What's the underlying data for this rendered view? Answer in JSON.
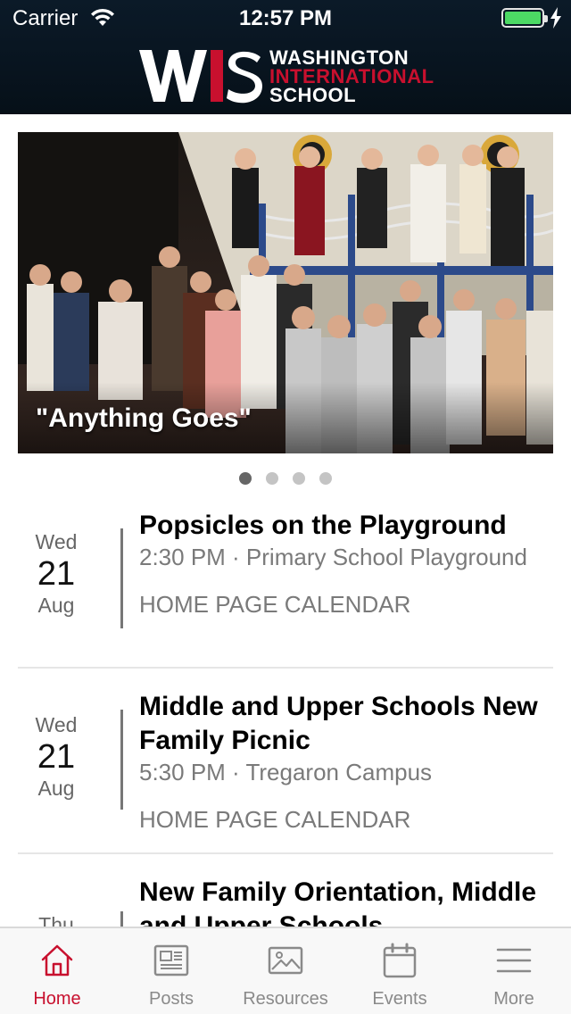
{
  "status_bar": {
    "carrier": "Carrier",
    "time": "12:57 PM"
  },
  "header": {
    "logo_mark": "WIS",
    "logo_line1": "WASHINGTON",
    "logo_line2": "INTERNATIONAL",
    "logo_line3": "SCHOOL",
    "brand_red": "#c8102e",
    "brand_navy": "#0b1a28"
  },
  "carousel": {
    "caption": "\"Anything Goes\"",
    "slide_count": 4,
    "active_slide": 1
  },
  "events": [
    {
      "dow": "Wed",
      "day": "21",
      "month": "Aug",
      "title": "Popsicles on the Playground",
      "meta": "2:30 PM · Primary School Playground",
      "calendar": "HOME PAGE CALENDAR"
    },
    {
      "dow": "Wed",
      "day": "21",
      "month": "Aug",
      "title": "Middle and Upper Schools New Family Picnic",
      "meta": "5:30 PM · Tregaron Campus",
      "calendar": "HOME PAGE CALENDAR"
    },
    {
      "dow": "Thu",
      "day": "",
      "month": "",
      "title": "New Family Orientation, Middle and Upper Schools",
      "meta": "",
      "calendar": ""
    }
  ],
  "tabbar": {
    "tabs": [
      {
        "label": "Home",
        "icon": "home-icon",
        "active": true
      },
      {
        "label": "Posts",
        "icon": "newspaper-icon",
        "active": false
      },
      {
        "label": "Resources",
        "icon": "image-icon",
        "active": false
      },
      {
        "label": "Events",
        "icon": "calendar-icon",
        "active": false
      },
      {
        "label": "More",
        "icon": "menu-icon",
        "active": false
      }
    ],
    "active_color": "#c8102e",
    "inactive_color": "#8a8a8a"
  }
}
